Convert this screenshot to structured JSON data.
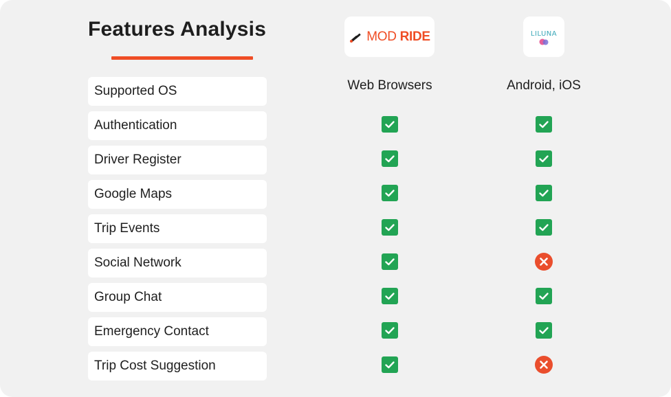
{
  "header": {
    "title": "Features Analysis"
  },
  "products": [
    {
      "logo_text_light": "MOD ",
      "logo_text_bold": "RIDE",
      "platform": "Web Browsers"
    },
    {
      "logo_text": "LILUNA",
      "platform": "Android, iOS"
    }
  ],
  "colors": {
    "accent": "#ef4d25",
    "check": "#22a454",
    "cross": "#ea4e2d",
    "card_bg": "#f1f1f1"
  },
  "features": [
    {
      "label": "Supported OS"
    },
    {
      "label": "Authentication",
      "modride": true,
      "liluna": true
    },
    {
      "label": "Driver Register",
      "modride": true,
      "liluna": true
    },
    {
      "label": "Google Maps",
      "modride": true,
      "liluna": true
    },
    {
      "label": "Trip Events",
      "modride": true,
      "liluna": true
    },
    {
      "label": "Social Network",
      "modride": true,
      "liluna": false
    },
    {
      "label": "Group Chat",
      "modride": true,
      "liluna": true
    },
    {
      "label": "Emergency Contact",
      "modride": true,
      "liluna": true
    },
    {
      "label": "Trip Cost Suggestion",
      "modride": true,
      "liluna": false
    }
  ]
}
